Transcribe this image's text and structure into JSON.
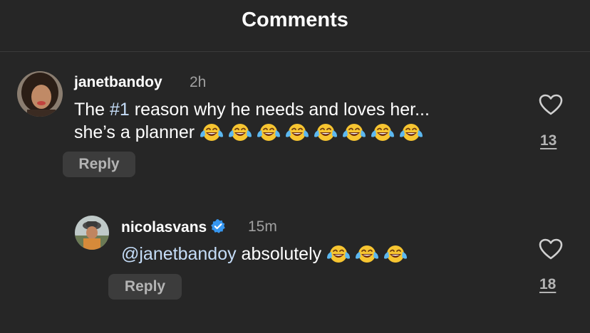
{
  "header": {
    "title": "Comments"
  },
  "comments": [
    {
      "username": "janetbandoy",
      "time": "2h",
      "text_line1_before": "The ",
      "hashtag": "#1",
      "text_line1_after": " reason why he needs and loves her...",
      "text_line2": "she’s a planner",
      "emoji_name": "face-with-tears-of-joy-emoji",
      "emoji_count": 8,
      "reply_label": "Reply",
      "likes": "13"
    },
    {
      "username": "nicolasvans",
      "verified": true,
      "time": "15m",
      "mention": "@janetbandoy",
      "text_after_mention": " absolutely",
      "emoji_name": "face-with-tears-of-joy-emoji",
      "emoji_count": 3,
      "reply_label": "Reply",
      "likes": "18"
    }
  ],
  "colors": {
    "background": "#262626",
    "text": "#ffffff",
    "muted": "#a0a0a0",
    "link": "#c5ddf8",
    "reply_bg": "#3c3c3c",
    "verified": "#3797f0"
  }
}
